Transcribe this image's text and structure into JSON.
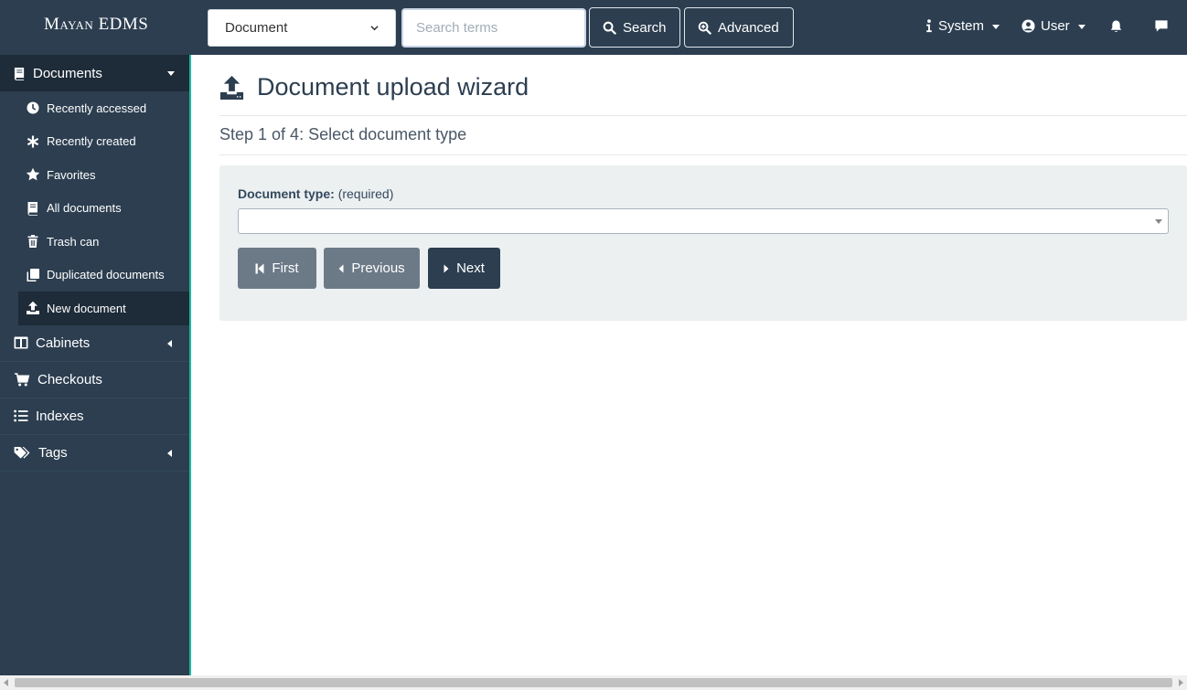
{
  "navbar": {
    "brand": "Mayan EDMS",
    "search_type": "Document",
    "search_placeholder": "Search terms",
    "search_label": "Search",
    "advanced_label": "Advanced",
    "system_label": "System",
    "user_label": "User"
  },
  "sidebar": {
    "documents_label": "Documents",
    "sub_items": [
      {
        "label": "Recently accessed",
        "icon": "clock-icon"
      },
      {
        "label": "Recently created",
        "icon": "asterisk-icon"
      },
      {
        "label": "Favorites",
        "icon": "star-icon"
      },
      {
        "label": "All documents",
        "icon": "book-icon"
      },
      {
        "label": "Trash can",
        "icon": "trash-icon"
      },
      {
        "label": "Duplicated documents",
        "icon": "copy-icon"
      },
      {
        "label": "New document",
        "icon": "upload-icon"
      }
    ],
    "cabinets_label": "Cabinets",
    "checkouts_label": "Checkouts",
    "indexes_label": "Indexes",
    "tags_label": "Tags"
  },
  "main": {
    "title": "Document upload wizard",
    "step": "Step 1 of 4: Select document type",
    "field_label": "Document type:",
    "field_required": "(required)",
    "field_value": "",
    "first_label": "First",
    "previous_label": "Previous",
    "next_label": "Next"
  },
  "colors": {
    "navbar": "#2c3e50",
    "accent": "#18bc9c",
    "panel": "#ecf0f1",
    "button_disabled": "#6c7a88",
    "button_primary": "#2c3e50"
  }
}
